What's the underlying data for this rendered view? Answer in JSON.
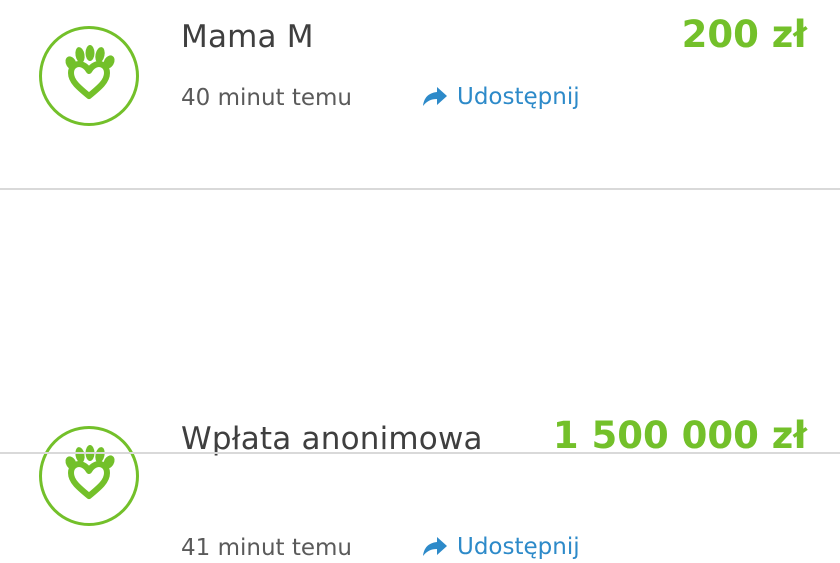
{
  "accent_color": "#73c02a",
  "link_color": "#2d8ac9",
  "donations": [
    {
      "name": "Mama M",
      "time": "40 minut temu",
      "share_label": "Udostępnij",
      "amount": "200 zł",
      "avatar_icon": "heart-hand-icon",
      "share_icon": "share-arrow-icon"
    },
    {
      "name": "Wpłata anonimowa",
      "time": "41 minut temu",
      "share_label": "Udostępnij",
      "amount": "1 500 000 zł",
      "avatar_icon": "heart-hand-icon",
      "share_icon": "share-arrow-icon"
    }
  ]
}
